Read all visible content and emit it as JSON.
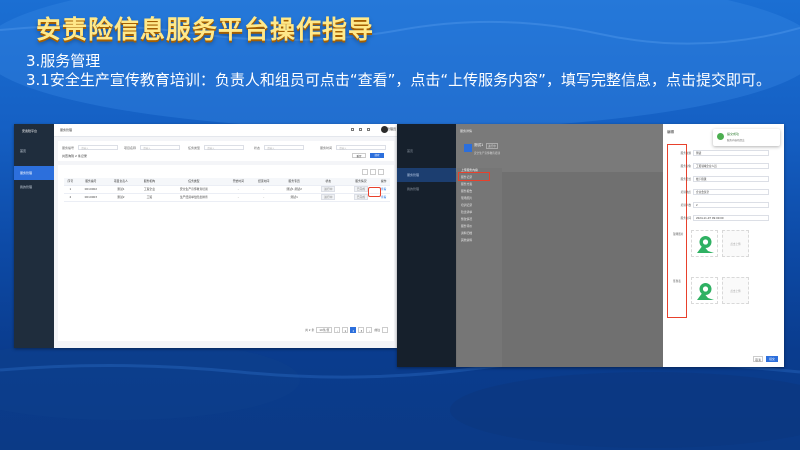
{
  "title": "安责险信息服务平台操作指导",
  "para1": "3.服务管理",
  "para2": "3.1安全生产宣传教育培训：负责人和组员可点击“查看”，点击“上传服务内容”，填写完整信息，点击提交即可。",
  "screenshot_left": {
    "sidebar_logo": "安责险平台",
    "nav": [
      "首页",
      "服务管理",
      "我的管理"
    ],
    "topbar_title": "服务管理",
    "user_name": "管理员",
    "filters": [
      "服务编号",
      "项目名称",
      "任务类型",
      "状态",
      "服务时间"
    ],
    "filter_placeholder": "请输入",
    "tip": "共查询到 2 条记录",
    "btn_reset": "重置",
    "btn_search": "搜索",
    "table": {
      "headers": [
        "序号",
        "服务编号",
        "项目负责人",
        "服务机构",
        "任务类型",
        "开始时间",
        "结束时间",
        "服务专员",
        "状态",
        "服务情况",
        "操作"
      ],
      "rows": [
        [
          "1",
          "0010002",
          "测试1",
          "工贸企业",
          "安全生产宣传教育培训",
          "-",
          "-",
          "测试1,测试2",
          "进行中",
          "已完成",
          "查看"
        ],
        [
          "2",
          "0010003",
          "测试2",
          "工贸",
          "生产经营单位隐患排查",
          "-",
          "-",
          "测试1",
          "进行中",
          "已完成",
          "查看"
        ]
      ]
    },
    "pager": {
      "total": "共 2 条",
      "size": "10条/页",
      "pages": [
        "1",
        "2",
        "3"
      ],
      "current": "2",
      "goto": "前往"
    }
  },
  "screenshot_right": {
    "nav": [
      "首页",
      "服务管理",
      "我的管理"
    ],
    "card_title": "服务详情",
    "badge": "进行中",
    "project": "测试1",
    "project_desc": "安全生产宣传教育培训",
    "menu_items": [
      "上传服务内容",
      "服务记录",
      "服务方案",
      "服务报告",
      "现场照片",
      "培训记录",
      "隐患清单",
      "整改情况",
      "服务评价",
      "资料归档",
      "其他资料"
    ],
    "dialog": {
      "title": "编辑",
      "close": "×",
      "fields": [
        {
          "label": "服务主题",
          "value": "测试"
        },
        {
          "label": "服务对象",
          "value": "工贸领域企业人员"
        },
        {
          "label": "服务形式",
          "value": "线下授课"
        },
        {
          "label": "培训地点",
          "value": "企业会议室"
        },
        {
          "label": "培训人数",
          "value": "2"
        },
        {
          "label": "服务时间",
          "value": "2024-11-07 09:00:00"
        }
      ],
      "upload_label_1": "现场照片",
      "upload_label_2": "签到表",
      "upload_hint": "点击上传",
      "btn_cancel": "取消",
      "btn_submit": "提交"
    },
    "toast": {
      "title": "提交成功",
      "message": "服务内容已提交"
    }
  }
}
